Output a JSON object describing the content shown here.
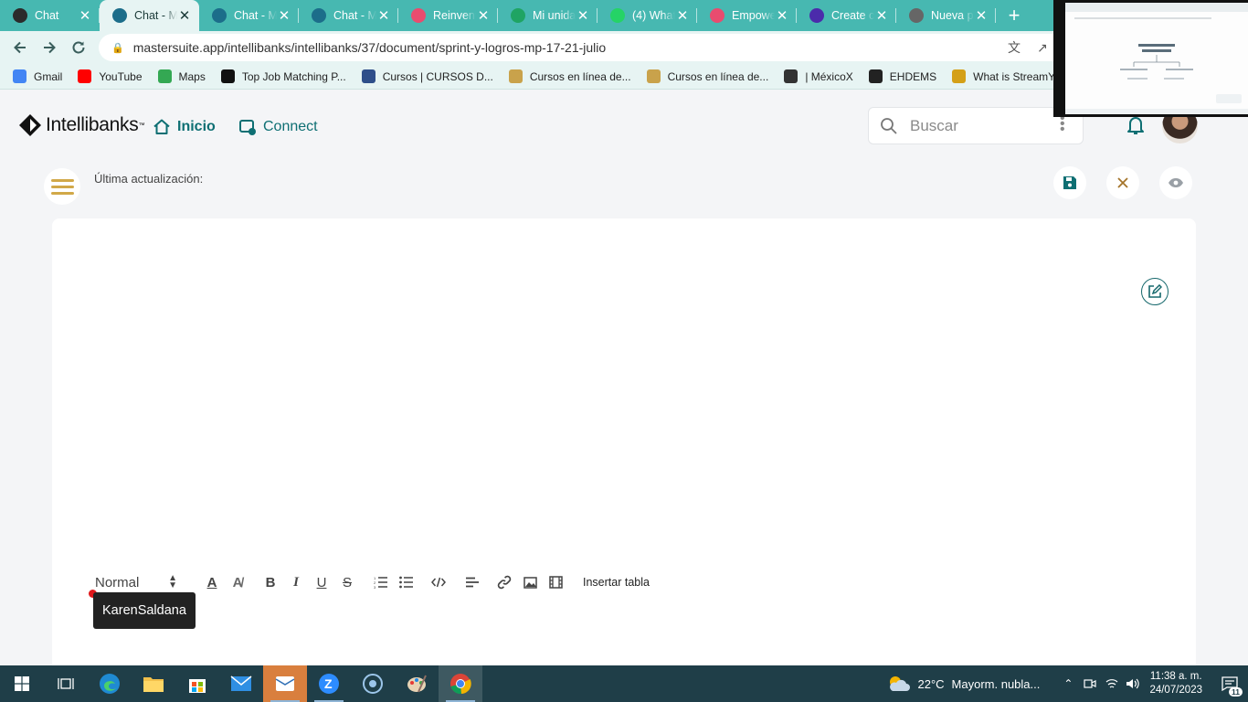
{
  "browser": {
    "tabs": [
      {
        "title": "Chat",
        "icon": "angular-icon",
        "color": "#2b2b2b",
        "active": false
      },
      {
        "title": "Chat - M",
        "icon": "chat-m-icon",
        "color": "#1c6d8a",
        "active": true
      },
      {
        "title": "Chat - M",
        "icon": "chat-m-icon",
        "color": "#1c6d8a",
        "active": false
      },
      {
        "title": "Chat - M",
        "icon": "chat-m-icon",
        "color": "#1c6d8a",
        "active": false
      },
      {
        "title": "Reinvent",
        "icon": "reinvent-icon",
        "color": "#e84c6f",
        "active": false
      },
      {
        "title": "Mi unida",
        "icon": "google-drive-icon",
        "color": "#1fa463",
        "active": false
      },
      {
        "title": "(4) What",
        "icon": "whatsapp-icon",
        "color": "#25d366",
        "active": false
      },
      {
        "title": "Empowe",
        "icon": "empower-icon",
        "color": "#e84c6f",
        "active": false
      },
      {
        "title": "Create c",
        "icon": "l-letter-icon",
        "color": "#4b2bab",
        "active": false
      },
      {
        "title": "Nueva p",
        "icon": "chrome-icon",
        "color": "#666666",
        "active": false
      }
    ],
    "new_tab_symbol": "+",
    "close_symbol": "✕",
    "url": "mastersuite.app/intellibanks/intellibanks/37/document/sprint-y-logros-mp-17-21-julio",
    "bookmarks": [
      {
        "label": "Gmail",
        "icon": "google-icon",
        "color": "#4285f4"
      },
      {
        "label": "YouTube",
        "icon": "youtube-icon",
        "color": "#ff0000"
      },
      {
        "label": "Maps",
        "icon": "maps-icon",
        "color": "#34a853"
      },
      {
        "label": "Top Job Matching P...",
        "icon": "arrow-circle-icon",
        "color": "#111111"
      },
      {
        "label": "Cursos | CURSOS D...",
        "icon": "c-box-icon",
        "color": "#2f4f8a"
      },
      {
        "label": "Cursos en línea de...",
        "icon": "owl-icon",
        "color": "#c9a24b"
      },
      {
        "label": "Cursos en línea de...",
        "icon": "owl-icon",
        "color": "#c9a24b"
      },
      {
        "label": "| MéxicoX",
        "icon": "mexicox-icon",
        "color": "#333333"
      },
      {
        "label": "EHDEMS",
        "icon": "globe-icon",
        "color": "#222222"
      },
      {
        "label": "What is StreamYard...",
        "icon": "streamyard-icon",
        "color": "#d4a017"
      }
    ]
  },
  "app": {
    "brand": "Intellibanks",
    "brand_tm": "™",
    "nav": {
      "inicio": "Inicio",
      "connect": "Connect"
    },
    "search_placeholder": "Buscar",
    "last_update_label": "Última actualización:",
    "accent": "#0e6f73",
    "menu_color": "#d1a848",
    "editor": {
      "format_select": "Normal",
      "insert_table": "Insertar tabla",
      "collaborator": "KarenSaldana"
    }
  },
  "taskbar": {
    "weather_temp": "22°C",
    "weather_text": "Mayorm. nubla...",
    "time": "11:38 a. m.",
    "date": "24/07/2023",
    "notification_count": "11"
  }
}
